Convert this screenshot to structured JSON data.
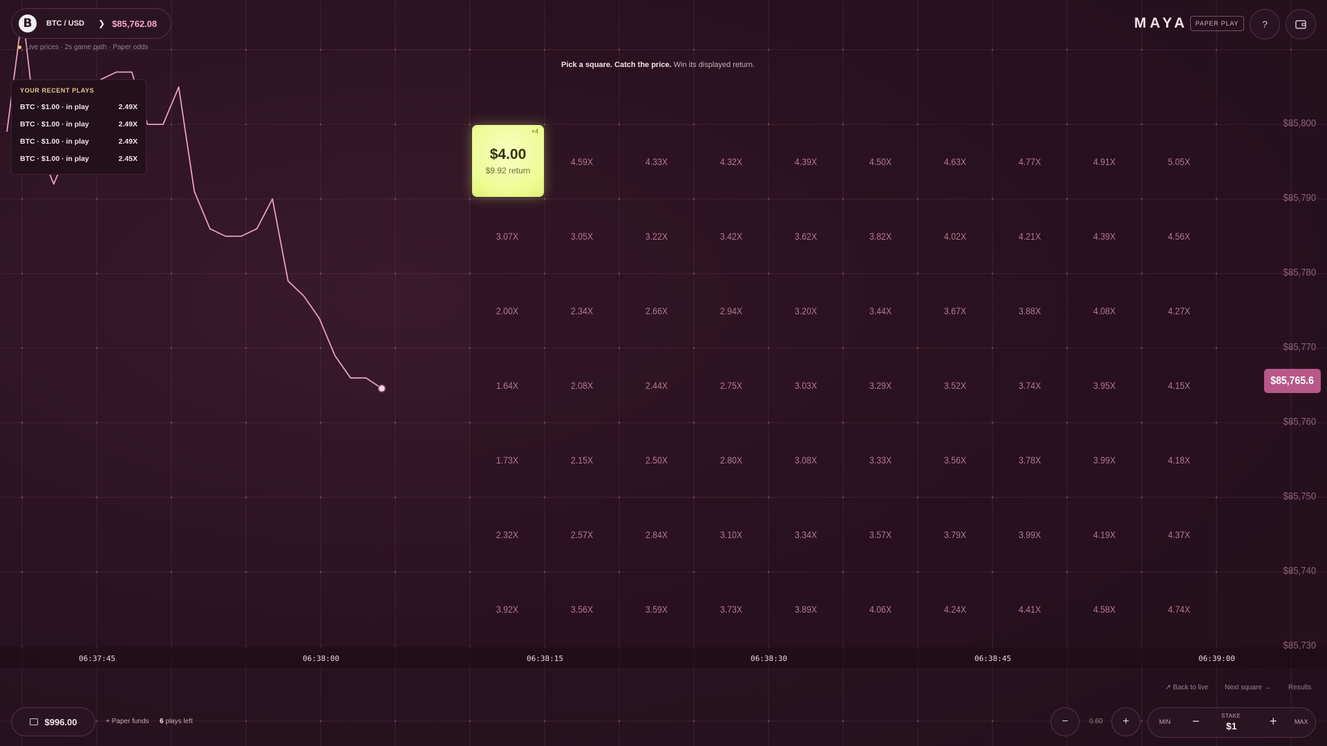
{
  "header": {
    "pair": "BTC / USD",
    "coin_symbol": "B",
    "price": "$85,762.08",
    "live_note": "Live prices · 2s game path · Paper odds",
    "brand": "MAYA",
    "mode_badge": "PAPER PLAY",
    "help_label": "?"
  },
  "recent_plays": {
    "title": "YOUR RECENT PLAYS",
    "items": [
      {
        "label": "BTC · $1.00 · in play",
        "mult": "2.49X"
      },
      {
        "label": "BTC · $1.00 · in play",
        "mult": "2.49X"
      },
      {
        "label": "BTC · $1.00 · in play",
        "mult": "2.49X"
      },
      {
        "label": "BTC · $1.00 · in play",
        "mult": "2.45X"
      }
    ]
  },
  "instruction": {
    "bold": "Pick a square. Catch the price.",
    "rest": " Win its displayed return."
  },
  "board": {
    "rows": [
      [
        "",
        "4.59X",
        "4.33X",
        "4.32X",
        "4.39X",
        "4.50X",
        "4.63X",
        "4.77X",
        "4.91X",
        "5.05X"
      ],
      [
        "3.07X",
        "3.05X",
        "3.22X",
        "3.42X",
        "3.62X",
        "3.82X",
        "4.02X",
        "4.21X",
        "4.39X",
        "4.56X"
      ],
      [
        "2.00X",
        "2.34X",
        "2.66X",
        "2.94X",
        "3.20X",
        "3.44X",
        "3.67X",
        "3.88X",
        "4.08X",
        "4.27X"
      ],
      [
        "1.64X",
        "2.08X",
        "2.44X",
        "2.75X",
        "3.03X",
        "3.29X",
        "3.52X",
        "3.74X",
        "3.95X",
        "4.15X"
      ],
      [
        "1.73X",
        "2.15X",
        "2.50X",
        "2.80X",
        "3.08X",
        "3.33X",
        "3.56X",
        "3.78X",
        "3.99X",
        "4.18X"
      ],
      [
        "2.32X",
        "2.57X",
        "2.84X",
        "3.10X",
        "3.34X",
        "3.57X",
        "3.79X",
        "3.99X",
        "4.19X",
        "4.37X"
      ],
      [
        "3.92X",
        "3.56X",
        "3.59X",
        "3.73X",
        "3.89X",
        "4.06X",
        "4.24X",
        "4.41X",
        "4.58X",
        "4.74X"
      ]
    ],
    "active": {
      "amount": "$4.00",
      "return": "$9.92 return",
      "badge": "×4"
    }
  },
  "price_axis": {
    "labels": [
      "$85,800",
      "$85,790",
      "$85,780",
      "$85,770",
      "$85,760",
      "$85,750",
      "$85,740",
      "$85,730"
    ],
    "current": "$85,765.6"
  },
  "time_axis": {
    "labels": [
      "06:37:45",
      "06:38:00",
      "06:38:15",
      "06:38:30",
      "06:38:45",
      "06:39:00"
    ]
  },
  "price_path": [
    85799,
    85815,
    85797,
    85792,
    85797,
    85801,
    85806,
    85807,
    85807,
    85800,
    85800,
    85805,
    85791,
    85786,
    85785,
    85785,
    85786,
    85790,
    85779,
    85777,
    85774,
    85769,
    85766,
    85766,
    85764.6
  ],
  "bottom": {
    "back_to_live": "↗ Back to live",
    "next_square": "Next square →",
    "results": "Results",
    "funds": "$996.00",
    "paper_funds": "+ Paper funds",
    "plays_count": "6",
    "plays_suffix": " plays left",
    "zoom_minus": "−",
    "zoom_value": "0.60",
    "zoom_plus": "+",
    "stake_min": "MIN",
    "stake_minus": "−",
    "stake_label": "STAKE",
    "stake_value": "$1",
    "stake_plus": "+",
    "stake_max": "MAX"
  },
  "colors": {
    "accent": "#b85888",
    "active_cell": "#ecfb92",
    "line": "#e4a1c0"
  }
}
